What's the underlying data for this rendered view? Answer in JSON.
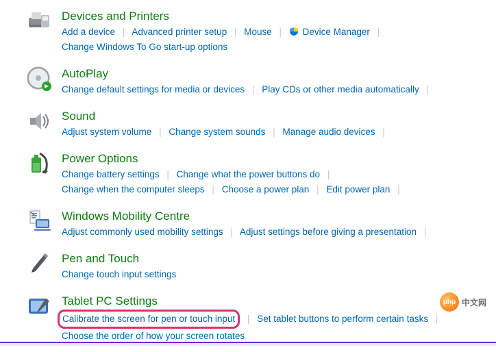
{
  "sections": {
    "devices": {
      "title": "Devices and Printers",
      "links": {
        "add": "Add a device",
        "advanced": "Advanced printer setup",
        "mouse": "Mouse",
        "devmgr": "Device Manager",
        "togo": "Change Windows To Go start-up options"
      }
    },
    "autoplay": {
      "title": "AutoPlay",
      "links": {
        "defaults": "Change default settings for media or devices",
        "playcd": "Play CDs or other media automatically"
      }
    },
    "sound": {
      "title": "Sound",
      "links": {
        "volume": "Adjust system volume",
        "sys": "Change system sounds",
        "manage": "Manage audio devices"
      }
    },
    "power": {
      "title": "Power Options",
      "links": {
        "battery": "Change battery settings",
        "buttons": "Change what the power buttons do",
        "sleep": "Change when the computer sleeps",
        "choose": "Choose a power plan",
        "edit": "Edit power plan"
      }
    },
    "mobility": {
      "title": "Windows Mobility Centre",
      "links": {
        "common": "Adjust commonly used mobility settings",
        "present": "Adjust settings before giving a presentation"
      }
    },
    "pentouch": {
      "title": "Pen and Touch",
      "links": {
        "change": "Change touch input settings"
      }
    },
    "tablet": {
      "title": "Tablet PC Settings",
      "links": {
        "calibrate": "Calibrate the screen for pen or touch input",
        "buttons": "Set tablet buttons to perform certain tasks",
        "order": "Choose the order of how your screen rotates"
      }
    }
  },
  "watermark": {
    "logo_text": "php",
    "label": "中文网"
  }
}
